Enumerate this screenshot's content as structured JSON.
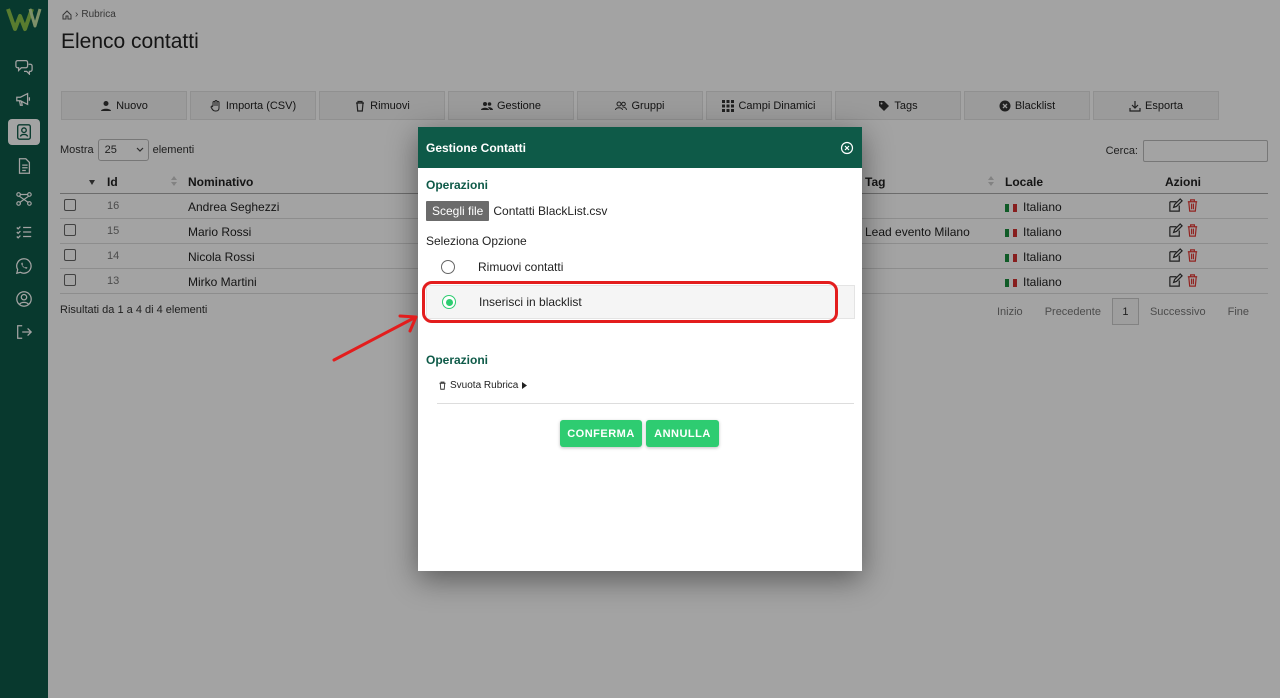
{
  "sidebar": {
    "icons": [
      "logo-icon",
      "chat-icon",
      "megaphone-icon",
      "contacts-icon",
      "document-icon",
      "flow-icon",
      "checklist-icon",
      "whatsapp-icon",
      "user-icon",
      "logout-icon"
    ],
    "active": "contacts-icon",
    "color": "#0e5a48"
  },
  "breadcrumb": {
    "home_icon": "home-icon",
    "label": "Rubrica"
  },
  "page": {
    "title": "Elenco contatti"
  },
  "toolbar": {
    "buttons": [
      {
        "label": "Nuovo",
        "icon": "user-add-icon"
      },
      {
        "label": "Importa (CSV)",
        "icon": "hand-icon"
      },
      {
        "label": "Rimuovi",
        "icon": "trash-icon"
      },
      {
        "label": "Gestione",
        "icon": "users-icon"
      },
      {
        "label": "Gruppi",
        "icon": "group-icon"
      },
      {
        "label": "Campi Dinamici",
        "icon": "grid-icon"
      },
      {
        "label": "Tags",
        "icon": "tag-icon"
      },
      {
        "label": "Blacklist",
        "icon": "block-icon"
      },
      {
        "label": "Esporta",
        "icon": "export-icon"
      }
    ]
  },
  "length_control": {
    "prefix": "Mostra",
    "value": "25",
    "suffix": "elementi"
  },
  "search": {
    "label": "Cerca:",
    "value": ""
  },
  "table": {
    "headers": {
      "id": "Id",
      "name": "Nominativo",
      "tag": "Tag",
      "locale": "Locale",
      "actions": "Azioni"
    },
    "rows": [
      {
        "id": "16",
        "name": "Andrea Seghezzi",
        "tag": "",
        "locale": "Italiano"
      },
      {
        "id": "15",
        "name": "Mario Rossi",
        "tag": "Lead evento Milano",
        "locale": "Italiano"
      },
      {
        "id": "14",
        "name": "Nicola Rossi",
        "tag": "",
        "locale": "Italiano"
      },
      {
        "id": "13",
        "name": "Mirko Martini",
        "tag": "",
        "locale": "Italiano"
      }
    ]
  },
  "results": "Risultati da 1 a 4 di 4 elementi",
  "pagination": {
    "first": "Inizio",
    "prev": "Precedente",
    "current": "1",
    "next": "Successivo",
    "last": "Fine"
  },
  "modal": {
    "title": "Gestione Contatti",
    "section1": "Operazioni",
    "file_button": "Scegli file",
    "file_name": "Contatti BlackList.csv",
    "option_label": "Seleziona Opzione",
    "options": [
      {
        "label": "Rimuovi contatti",
        "selected": false
      },
      {
        "label": "Inserisci in blacklist",
        "selected": true
      }
    ],
    "section2": "Operazioni",
    "svuota": "Svuota Rubrica",
    "confirm": "CONFERMA",
    "cancel": "ANNULLA",
    "accent": "#2ecc71"
  },
  "annotation_color": "#e31d1d"
}
